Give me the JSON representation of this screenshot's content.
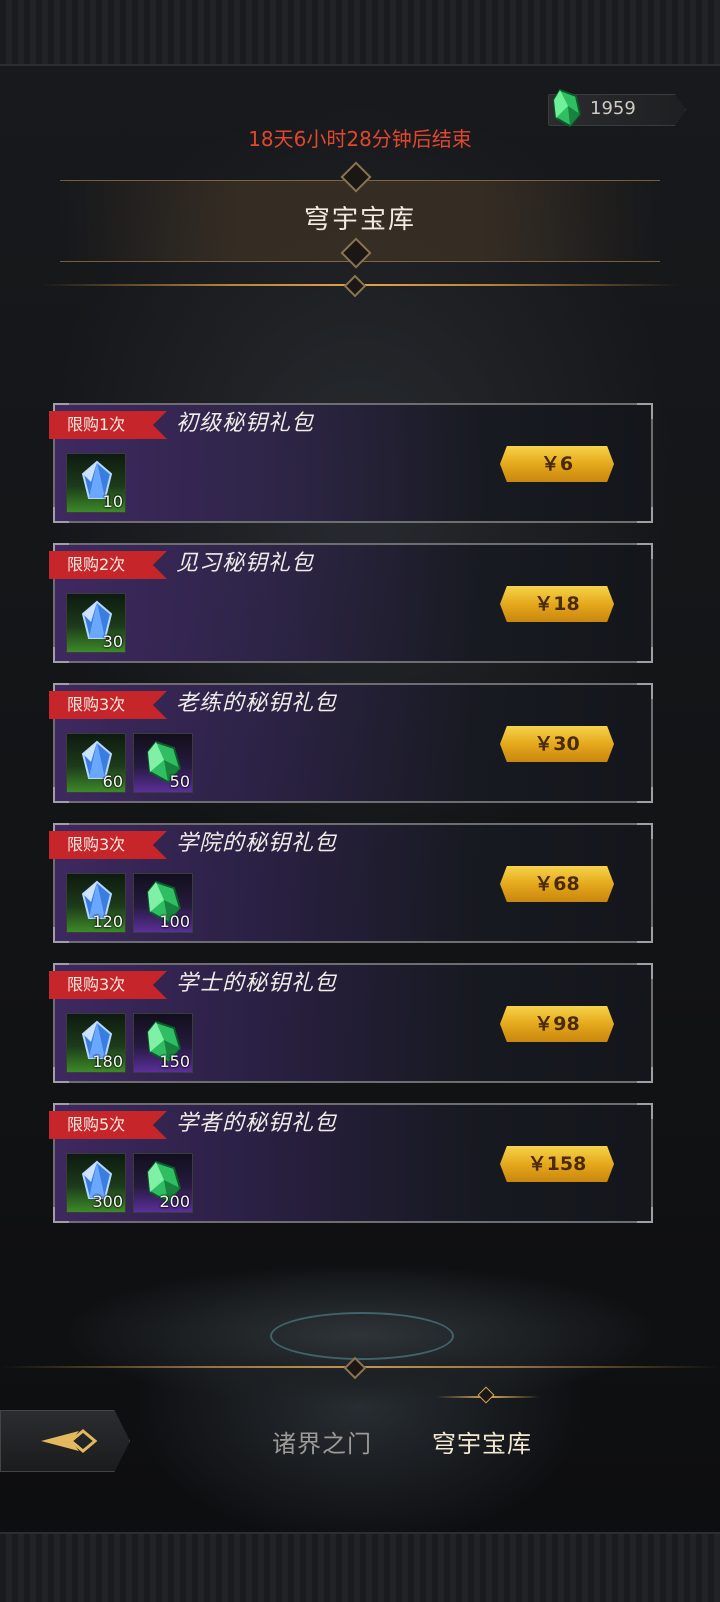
{
  "currency": {
    "amount": "1959",
    "icon": "green-crystal-icon"
  },
  "countdown": "18天6小时28分钟后结束",
  "title": "穹宇宝库",
  "packs": [
    {
      "limit": "限购1次",
      "name": "初级秘钥礼包",
      "price": "￥6",
      "items": [
        {
          "icon": "blue-gem-icon",
          "count": "10",
          "rarity": "green"
        }
      ]
    },
    {
      "limit": "限购2次",
      "name": "见习秘钥礼包",
      "price": "￥18",
      "items": [
        {
          "icon": "blue-gem-icon",
          "count": "30",
          "rarity": "green"
        }
      ]
    },
    {
      "limit": "限购3次",
      "name": "老练的秘钥礼包",
      "price": "￥30",
      "items": [
        {
          "icon": "blue-gem-icon",
          "count": "60",
          "rarity": "green"
        },
        {
          "icon": "green-crystal-icon",
          "count": "50",
          "rarity": "purple"
        }
      ]
    },
    {
      "limit": "限购3次",
      "name": "学院的秘钥礼包",
      "price": "￥68",
      "items": [
        {
          "icon": "blue-gem-icon",
          "count": "120",
          "rarity": "green"
        },
        {
          "icon": "green-crystal-icon",
          "count": "100",
          "rarity": "purple"
        }
      ]
    },
    {
      "limit": "限购3次",
      "name": "学士的秘钥礼包",
      "price": "￥98",
      "items": [
        {
          "icon": "blue-gem-icon",
          "count": "180",
          "rarity": "green"
        },
        {
          "icon": "green-crystal-icon",
          "count": "150",
          "rarity": "purple"
        }
      ]
    },
    {
      "limit": "限购5次",
      "name": "学者的秘钥礼包",
      "price": "￥158",
      "items": [
        {
          "icon": "blue-gem-icon",
          "count": "300",
          "rarity": "green"
        },
        {
          "icon": "green-crystal-icon",
          "count": "200",
          "rarity": "purple"
        }
      ]
    }
  ],
  "nav": {
    "back_icon": "back-arrow-icon",
    "tabs": [
      {
        "label": "诸界之门",
        "active": false
      },
      {
        "label": "穹宇宝库",
        "active": true
      }
    ]
  },
  "colors": {
    "countdown": "#e0472e",
    "limit_tag": "#c6262a",
    "price_button": "#e5a91c"
  }
}
